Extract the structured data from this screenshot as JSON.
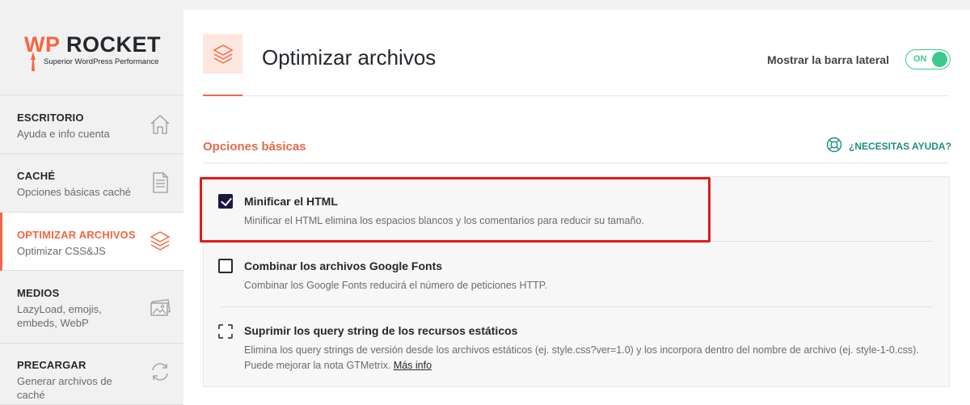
{
  "brand": {
    "wp": "WP",
    "name": "ROCKET",
    "tagline": "Superior WordPress Performance"
  },
  "sidebar": {
    "items": [
      {
        "title": "ESCRITORIO",
        "subtitle": "Ayuda e info cuenta",
        "icon": "home-icon",
        "active": false
      },
      {
        "title": "CACHÉ",
        "subtitle": "Opciones básicas caché",
        "icon": "document-icon",
        "active": false
      },
      {
        "title": "OPTIMIZAR ARCHIVOS",
        "subtitle": "Optimizar CSS&JS",
        "icon": "layers-icon",
        "active": true
      },
      {
        "title": "MEDIOS",
        "subtitle": "LazyLoad, emojis, embeds, WebP",
        "icon": "images-icon",
        "active": false
      },
      {
        "title": "PRECARGAR",
        "subtitle": "Generar archivos de caché",
        "icon": "refresh-icon",
        "active": false
      }
    ]
  },
  "header": {
    "title": "Optimizar archivos",
    "icon": "layers-icon",
    "sidebar_toggle_label": "Mostrar la barra lateral",
    "toggle_state": "ON"
  },
  "section": {
    "title": "Opciones básicas",
    "help_label": "¿NECESITAS AYUDA?",
    "help_icon": "lifebuoy-icon"
  },
  "options": [
    {
      "title": "Minificar el HTML",
      "description": "Minificar el HTML elimina los espacios blancos y los comentarios para reducir su tamaño.",
      "state": "checked"
    },
    {
      "title": "Combinar los archivos Google Fonts",
      "description": "Combinar los Google Fonts reducirá el número de peticiones HTTP.",
      "state": "unchecked"
    },
    {
      "title": "Suprimir los query string de los recursos estáticos",
      "description": "Elimina los query strings de versión desde los archivos estáticos (ej. style.css?ver=1.0) y los incorpora dentro del nombre de archivo (ej. style-1-0.css). Puede mejorar la nota GTMetrix.",
      "link": "Más info",
      "state": "disabled"
    }
  ],
  "colors": {
    "accent": "#f56640",
    "section_title": "#e66a47",
    "toggle_on": "#3cc98e",
    "help_text": "#1b8f82",
    "checkbox_checked": "#1f1541",
    "highlight": "#e01b1b"
  }
}
